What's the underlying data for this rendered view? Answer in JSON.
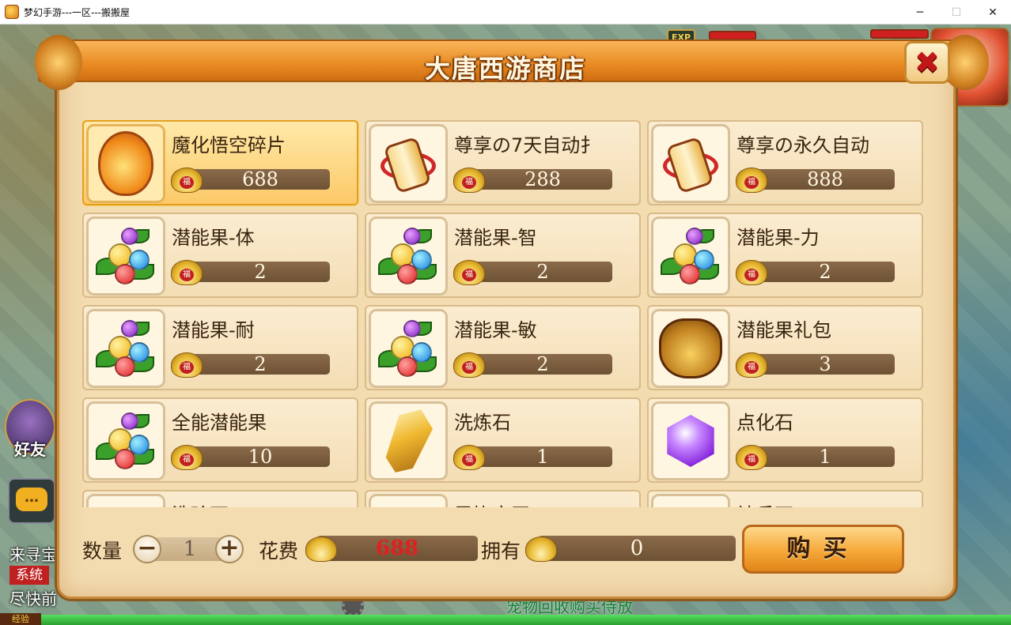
{
  "window": {
    "title": "梦幻手游---一区---搬搬屋",
    "minimize": "─",
    "maximize": "☐",
    "close": "✕"
  },
  "hud": {
    "exp_badge": "EXP",
    "friend_label": "好友",
    "chat_icon": "…",
    "left_text_1": "来寻宝",
    "system_tag": "系统",
    "left_text_2": "尽快前",
    "exp_label": "经验",
    "bottom_banner": "宠物回收购买侍放"
  },
  "shop": {
    "title": "大唐西游商店",
    "close_glyph": "✖",
    "items": [
      {
        "name": "魔化悟空碎片",
        "price": "688",
        "icon": "egg-icon",
        "selected": true
      },
      {
        "name": "尊享の7天自动扌",
        "price": "288",
        "icon": "scroll-icon",
        "selected": false
      },
      {
        "name": "尊享の永久自动",
        "price": "888",
        "icon": "scroll-icon",
        "selected": false
      },
      {
        "name": "潜能果-体",
        "price": "2",
        "icon": "fruit-icon",
        "selected": false
      },
      {
        "name": "潜能果-智",
        "price": "2",
        "icon": "fruit-icon",
        "selected": false
      },
      {
        "name": "潜能果-力",
        "price": "2",
        "icon": "fruit-icon",
        "selected": false
      },
      {
        "name": "潜能果-耐",
        "price": "2",
        "icon": "fruit-icon",
        "selected": false
      },
      {
        "name": "潜能果-敏",
        "price": "2",
        "icon": "fruit-icon",
        "selected": false
      },
      {
        "name": "潜能果礼包",
        "price": "3",
        "icon": "gift-bag-icon",
        "selected": false
      },
      {
        "name": "全能潜能果",
        "price": "10",
        "icon": "fruit-icon",
        "selected": false
      },
      {
        "name": "洗炼石",
        "price": "1",
        "icon": "gold-crystal-icon",
        "selected": false
      },
      {
        "name": "点化石",
        "price": "1",
        "icon": "purple-gem-icon",
        "selected": false
      },
      {
        "name": "洗珍石",
        "price": "",
        "icon": "item-icon",
        "selected": false
      },
      {
        "name": "灵饰宝玉",
        "price": "",
        "icon": "item-icon",
        "selected": false
      },
      {
        "name": "神兵石",
        "price": "",
        "icon": "item-icon",
        "selected": false
      }
    ],
    "footer": {
      "quantity_label": "数量",
      "quantity_minus": "−",
      "quantity_value": "1",
      "quantity_plus": "+",
      "cost_label": "花费",
      "cost_value": "688",
      "owned_label": "拥有",
      "owned_value": "0",
      "buy_label": "购买"
    }
  }
}
